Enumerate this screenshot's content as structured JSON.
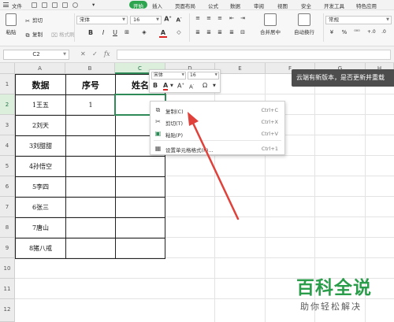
{
  "menubar": {
    "file_label": "文件",
    "tabs": [
      "开始",
      "插入",
      "页面布局",
      "公式",
      "数据",
      "审阅",
      "视图",
      "安全",
      "开发工具",
      "特色应用"
    ],
    "active_tab": "开始"
  },
  "ribbon": {
    "paste_label": "粘贴",
    "cut_label": "剪切",
    "copy_label": "复制",
    "format_painter_label": "格式刷",
    "font_name": "宋体",
    "font_size": "16",
    "bold": "B",
    "italic": "I",
    "underline": "U",
    "font_color": "A",
    "merge_label": "合并居中",
    "wrap_label": "自动换行",
    "number_format": "常规",
    "currency_symbol": "¥",
    "percent_symbol": "%",
    "grow_font": "A",
    "shrink_font": "A"
  },
  "formula_bar": {
    "cell_ref": "C2",
    "fx_label": "fx",
    "value": ""
  },
  "sheet": {
    "columns": [
      "A",
      "B",
      "C",
      "D",
      "E",
      "F",
      "G",
      "H"
    ],
    "rows": [
      "1",
      "2",
      "3",
      "4",
      "5",
      "6",
      "7",
      "8",
      "9",
      "10",
      "11",
      "12"
    ],
    "table_header": [
      "数据",
      "序号",
      "姓名"
    ],
    "table_rows": [
      [
        "1王五",
        "1",
        ""
      ],
      [
        "2刘天",
        "",
        ""
      ],
      [
        "3刘甜甜",
        "",
        ""
      ],
      [
        "4孙悟空",
        "",
        ""
      ],
      [
        "5李四",
        "",
        ""
      ],
      [
        "6张三",
        "",
        ""
      ],
      [
        "7唐山",
        "",
        ""
      ],
      [
        "8猪八戒",
        "",
        ""
      ]
    ],
    "selected_cell": "C2"
  },
  "mini_toolbar": {
    "font_name": "宋体",
    "font_size": "16",
    "bold": "B",
    "font_color": "A",
    "grow": "A",
    "shrink": "A",
    "symbol": "Ω"
  },
  "context_menu": {
    "items": [
      {
        "label": "复制(C)",
        "shortcut": "Ctrl+C",
        "icon": "copy-icon"
      },
      {
        "label": "剪切(T)",
        "shortcut": "Ctrl+X",
        "icon": "scissors-icon"
      },
      {
        "label": "粘贴(P)",
        "shortcut": "Ctrl+V",
        "icon": "paste-icon"
      },
      {
        "label": "设置单元格格式(F)...",
        "shortcut": "Ctrl+1",
        "icon": "format-cells-icon"
      }
    ]
  },
  "notification": {
    "text": "云端有新版本，是否更新并重载"
  },
  "watermark": {
    "title": "百科全说",
    "subtitle": "助你轻松解决"
  },
  "colors": {
    "accent_green": "#2da44e",
    "selection_green": "#2e8b57",
    "arrow_red": "#e0413a",
    "watermark_green": "#2a9d4a"
  }
}
